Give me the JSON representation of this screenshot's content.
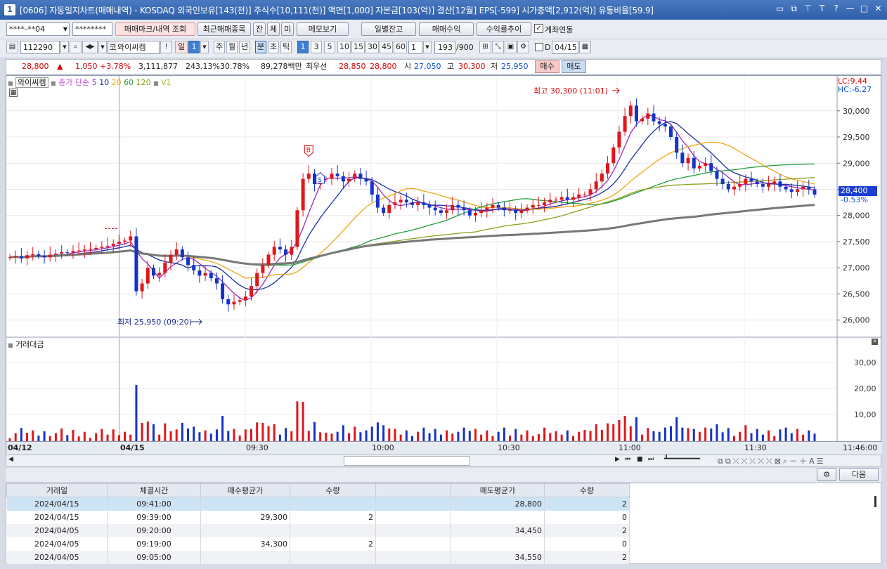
{
  "window": {
    "num": "1",
    "title": "[0606] 자동일지차트(매매내역) - KOSDAQ 외국인보유[143(천)] 주식수[10,111(천)] 액면[1,000] 자본금[103(억)] 결산[12월] EPS[-599] 시가총액[2,912(억)] 유통비율[59.9]"
  },
  "toolbar1": {
    "account": "****-**04",
    "password": "********",
    "btn_trade_mark": "매매마크/내역 조회",
    "btn_recent": "최근매매종목",
    "btn_jan": "잔",
    "btn_che": "체",
    "btn_mi": "미",
    "btn_memo": "메모보기",
    "btn_daily_balance": "일별잔고",
    "btn_trade_profit": "매매수익",
    "btn_profit_trend": "수익률추이",
    "chk_account_link": "계좌연동"
  },
  "toolbar2": {
    "code": "112290",
    "stock_name": "와이씨켐",
    "period_il": "일",
    "period_num": "1",
    "period_ju": "주",
    "period_wol": "월",
    "period_nyeon": "년",
    "period_bun": "분",
    "period_cho": "초",
    "period_tik": "틱",
    "minutes": [
      "1",
      "3",
      "5",
      "10",
      "15",
      "30",
      "45",
      "60"
    ],
    "interval_select": "1",
    "count": "193",
    "count_max": "/900",
    "d_label": "D",
    "date": "04/15"
  },
  "infobar": {
    "price": "28,800",
    "change": "1,050",
    "change_pct": "+3.78%",
    "volume": "3,111,877",
    "vol_ratio": "243.13%",
    "turnover_pct": "30.78%",
    "amount": "89,278백만",
    "best_ask_label": "최우선",
    "ask": "28,850",
    "bid": "28,800",
    "open_label": "시",
    "open": "27,050",
    "high_label": "고",
    "high": "30,300",
    "low_label": "저",
    "low": "25,950",
    "buy_btn": "매수",
    "sell_btn": "매도"
  },
  "chart_legend": {
    "name": "와이씨켐",
    "ma_label": "종가 단순",
    "ma": [
      "5",
      "10",
      "20",
      "60",
      "120"
    ],
    "v1": "V1"
  },
  "colors": {
    "up": "#e0161b",
    "down": "#1433c8",
    "ma5": "#9a2bbd",
    "ma10": "#1b2fa5",
    "ma20": "#f0a516",
    "ma60": "#229e3a",
    "ma120": "#8e9f1a",
    "ma_long": "#777777",
    "yellowgreen": "#a8c21a"
  },
  "chart_data": {
    "type": "candlestick",
    "price_axis": {
      "ticks": [
        "30,000",
        "29,500",
        "29,000",
        "28,500",
        "28,000",
        "27,500",
        "27,000",
        "26,500",
        "26,000"
      ],
      "ylim": [
        25700,
        30400
      ]
    },
    "volume_axis": {
      "ticks": [
        "30,00",
        "20,00",
        "10,00"
      ],
      "title": "거래대금"
    },
    "time_labels": [
      "04/12",
      "04/15",
      "09:30",
      "10:00",
      "10:30",
      "11:00",
      "11:30",
      "11:46:00"
    ],
    "high_annotation": "최고 30,300 (11:01)",
    "low_annotation": "최저 25,950 (09:20)",
    "current_price_tag": "28,400",
    "current_pct": "-0.53%",
    "lc": "LC:9.44",
    "hc": "HC:-6.27",
    "markers": [
      "B",
      "S"
    ],
    "closes": [
      27200,
      27220,
      27180,
      27240,
      27260,
      27230,
      27200,
      27250,
      27270,
      27300,
      27290,
      27320,
      27330,
      27350,
      27360,
      27380,
      27400,
      27420,
      27460,
      27500,
      27520,
      27600,
      26550,
      26700,
      27000,
      26850,
      26900,
      27100,
      27250,
      27350,
      27200,
      27050,
      26950,
      26850,
      26900,
      26800,
      26700,
      26400,
      26300,
      26350,
      26380,
      26450,
      26650,
      26900,
      27050,
      27250,
      27400,
      27350,
      27250,
      27400,
      28100,
      28700,
      28800,
      28600,
      28700,
      28700,
      28800,
      28750,
      28650,
      28700,
      28800,
      28700,
      28650,
      28400,
      28150,
      28050,
      28200,
      28250,
      28300,
      28250,
      28200,
      28250,
      28200,
      28150,
      28100,
      28050,
      28100,
      28200,
      28150,
      28100,
      28000,
      28050,
      28100,
      28150,
      28200,
      28150,
      28100,
      28100,
      28050,
      28100,
      28150,
      28200,
      28200,
      28250,
      28300,
      28300,
      28350,
      28300,
      28350,
      28400,
      28400,
      28500,
      28650,
      28800,
      29000,
      29300,
      29600,
      29900,
      30100,
      29800,
      29850,
      29950,
      29800,
      29750,
      29700,
      29500,
      29200,
      29000,
      29100,
      28900,
      28950,
      29000,
      28850,
      28700,
      28600,
      28500,
      28550,
      28600,
      28700,
      28650,
      28600,
      28550,
      28600,
      28650,
      28550,
      28500,
      28450,
      28500,
      28550,
      28500,
      28400
    ]
  },
  "grid": {
    "headers": [
      "거래일",
      "체결시간",
      "매수평균가",
      "수량",
      "",
      "매도평균가",
      "수량"
    ],
    "rows": [
      [
        "2024/04/15",
        "09:41:00",
        "",
        "",
        "",
        "28,800",
        "2"
      ],
      [
        "2024/04/15",
        "09:39:00",
        "29,300",
        "2",
        "",
        "",
        "0"
      ],
      [
        "2024/04/05",
        "09:20:00",
        "",
        "",
        "",
        "34,450",
        "2"
      ],
      [
        "2024/04/05",
        "09:19:00",
        "34,300",
        "2",
        "",
        "",
        "0"
      ],
      [
        "2024/04/05",
        "09:05:00",
        "",
        "",
        "",
        "34,550",
        "2"
      ]
    ],
    "next_btn": "다음"
  }
}
